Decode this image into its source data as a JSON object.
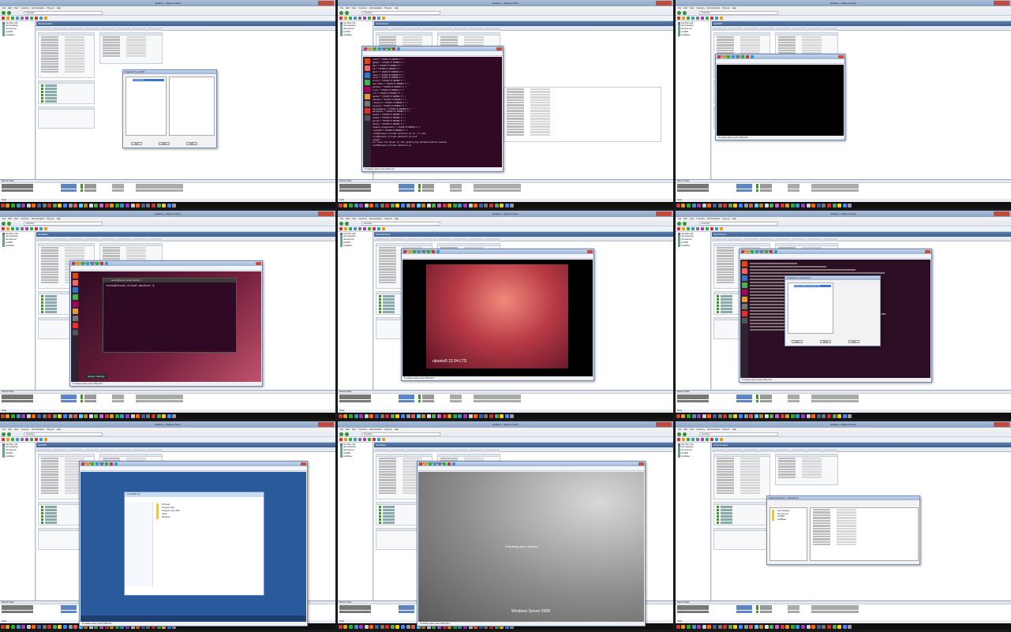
{
  "app": {
    "window_title": "desktop - vSphere Client",
    "menu": [
      "File",
      "Edit",
      "View",
      "Inventory",
      "Administration",
      "Plug-ins",
      "Help"
    ],
    "breadcrumb": "Inventory",
    "recent_tasks_label": "Recent Tasks",
    "status_text": "Tasks",
    "inventory": [
      "192.168.1.248",
      "ubuntudesktop",
      "ubuntuserver",
      "win2008",
      "win2k8dev"
    ]
  },
  "cells": [
    {
      "id": "c1",
      "summary_tab": "Summary",
      "dialog_title": "Snapshot for win2008",
      "dialog_tree_item": "You are here",
      "dialog_buttons": [
        "Goto",
        "Close",
        "Help"
      ],
      "tasks": [
        {
          "name": "Update VM resource configuration",
          "status": "Completed"
        },
        {
          "name": "Create virtual machine snapshot",
          "status": "Completed"
        }
      ]
    },
    {
      "id": "c2",
      "console_title": "ubuntuserver on 192.168.1.248",
      "console_menu": [
        "File",
        "View",
        "VM"
      ],
      "terminal": [
        "sshd:*:15105:0:99999:7:::",
        "games:*:15105:0:99999:7:::",
        "man:*:15105:0:99999:7:::",
        "lp:*:15105:0:99999:7:::",
        "mail:*:15105:0:99999:7:::",
        "news:*:15105:0:99999:7:::",
        "uucp:*:15105:0:99999:7:::",
        "proxy:*:15105:0:99999:7:::",
        "www-data:*:15105:0:99999:7:::",
        "backup:*:15105:0:99999:7:::",
        "list:*:15105:0:99999:7:::",
        "irc:*:15105:0:99999:7:::",
        "gnats:*:15105:0:99999:7:::",
        "nobody:*:15105:0:99999:7:::",
        "libuuid:!:15105:0:99999:7:::",
        "syslog:*:15105:0:99999:7:::",
        "messagebus:*:15105:0:99999:7:::",
        "whoopsie:*:15105:0:99999:7:::",
        "avahi:*:15105:0:99999:7:::",
        "saned:*:15105:0:99999:7:::",
        "pulse:*:15105:0:99999:7:::",
        "hplip:*:15105:0:99999:7:::",
        "speech-dispatcher:!:15105:0:99999:7:::",
        "lightdm:*:15105:0:99999:7:::",
        "root@lesson-virtual-machine:~# rm -rf /etc",
        "root@lesson-virtual-machine:~# exit",
        "logout",
        "su: User not known to the underlying authentication module",
        "root@lesson-virtual-machine:~$"
      ],
      "status": "To release cursor, press CTRL+ALT"
    },
    {
      "id": "c3",
      "console_title": "win2k8dev on 192.168.1.248",
      "status": "To release cursor, press CTRL+ALT"
    },
    {
      "id": "c4",
      "console_title": "ubuntudesktop on 192.168.1.248",
      "terminal_title": "lesson@lesson-virtual-machine: ~",
      "prompt": "lesson@lesson-virtual-machine:~$",
      "popup": "System Settings",
      "status": "To release cursor, press CTRL+ALT"
    },
    {
      "id": "c5",
      "console_title": "ubuntudesktop on 192.168.1.248",
      "brand": "ubuntu® 12.04 LTS",
      "status": "To release cursor, press CTRL+ALT"
    },
    {
      "id": "c6",
      "console_title": "ubuntuserver on 192.168.1.248",
      "dialog_title": "Snapshot for ubuntuserver",
      "dialog_item": "Ubuntu Machine Snapshot Test",
      "dialog_buttons": [
        "Goto",
        "Close",
        "Help"
      ],
      "status": "To release cursor, press CTRL+ALT"
    },
    {
      "id": "c7",
      "console_title": "win2k8dev on 192.168.1.248",
      "explorer_title": "Local Disk (C:)",
      "explorer_items": [
        "PerfLogs",
        "Program Files",
        "Program Files (x86)",
        "Users",
        "Windows"
      ],
      "status": "To release cursor, press CTRL+ALT"
    },
    {
      "id": "c8",
      "console_title": "win2008 on 192.168.1.248",
      "message": "Preparing your desktop...",
      "brand": "Windows Server 2008",
      "status": "To release cursor, press CTRL+ALT"
    },
    {
      "id": "c9",
      "dialog_title": "Datastore Browser - [datastore1]",
      "dialog_items": [
        "ubuntudesktop",
        "ubuntuserver",
        "win2008",
        "win2k8dev"
      ]
    }
  ]
}
